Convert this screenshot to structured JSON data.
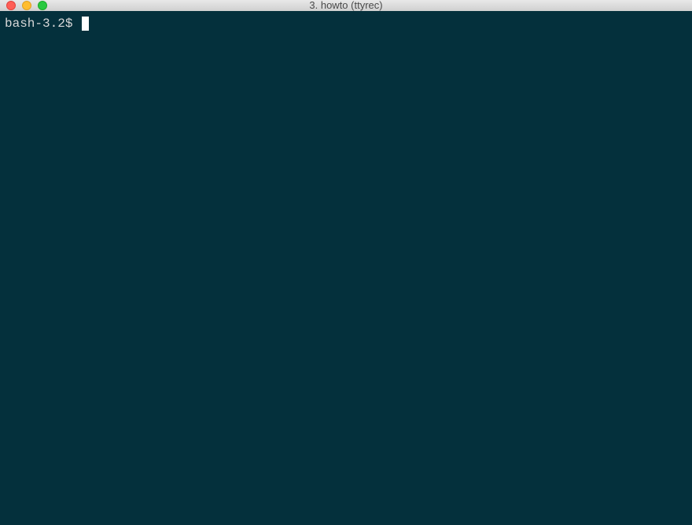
{
  "window": {
    "title": "3. howto (ttyrec)"
  },
  "terminal": {
    "prompt": "bash-3.2$ ",
    "input": ""
  }
}
